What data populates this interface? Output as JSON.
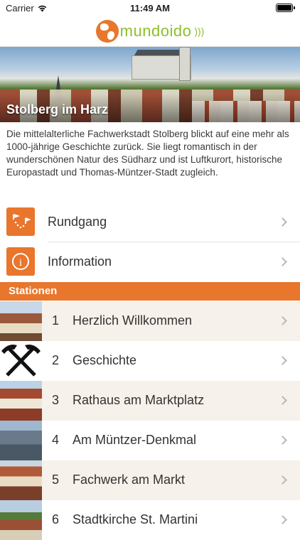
{
  "status": {
    "carrier": "Carrier",
    "time": "11:49 AM"
  },
  "brand": {
    "name": "mundoido"
  },
  "hero": {
    "title": "Stolberg im Harz"
  },
  "description": "Die mittelalterliche Fachwerkstadt Stolberg blickt auf eine mehr als 1000-jährige Geschichte zurück. Sie liegt romantisch in der wunderschönen Natur des Südharz und ist Luftkurort, historische Europastadt und Thomas-Müntzer-Stadt zugleich.",
  "menu": [
    {
      "label": "Rundgang",
      "icon": "route-map-icon"
    },
    {
      "label": "Information",
      "icon": "info-icon"
    }
  ],
  "section_title": "Stationen",
  "stations": [
    {
      "number": "1",
      "label": "Herzlich Willkommen"
    },
    {
      "number": "2",
      "label": "Geschichte"
    },
    {
      "number": "3",
      "label": "Rathaus am Marktplatz"
    },
    {
      "number": "4",
      "label": "Am Müntzer-Denkmal"
    },
    {
      "number": "5",
      "label": "Fachwerk am Markt"
    },
    {
      "number": "6",
      "label": "Stadtkirche St. Martini"
    }
  ],
  "colors": {
    "accent": "#e8762c",
    "brand_green": "#8cbf2a",
    "row_tint": "#f7f1eb"
  }
}
